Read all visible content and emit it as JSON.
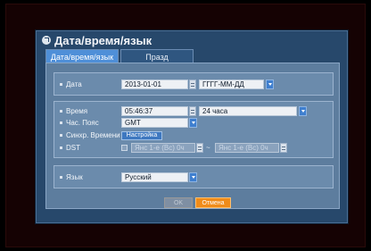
{
  "window": {
    "title": "Дата/время/язык"
  },
  "tabs": [
    {
      "label": "Дата/время/язык"
    },
    {
      "label": "Празд"
    }
  ],
  "date": {
    "label": "Дата",
    "value": "2013-01-01",
    "format": "ГГГГ-ММ-ДД"
  },
  "time": {
    "label": "Время",
    "value": "05:46:37",
    "mode": "24 часа"
  },
  "timezone": {
    "label": "Час. Пояс",
    "value": "GMT"
  },
  "sync": {
    "label": "Синхр. Времени",
    "button": "Настройка"
  },
  "dst": {
    "label": "DST",
    "start": "Янс 1-е (Вс) 0ч",
    "end": "Янс 1-е (Вс) 0ч",
    "separator": "~",
    "enabled": false
  },
  "language": {
    "label": "Язык",
    "value": "Русский"
  },
  "footer": {
    "ok": "OK",
    "cancel": "Отмена"
  },
  "colors": {
    "accent": "#4f8fd8",
    "cancel": "#f08c1a",
    "panel": "#5d7d9e"
  },
  "icons": {
    "title": "gear-icon",
    "dropdown": "chevron-down-icon"
  }
}
